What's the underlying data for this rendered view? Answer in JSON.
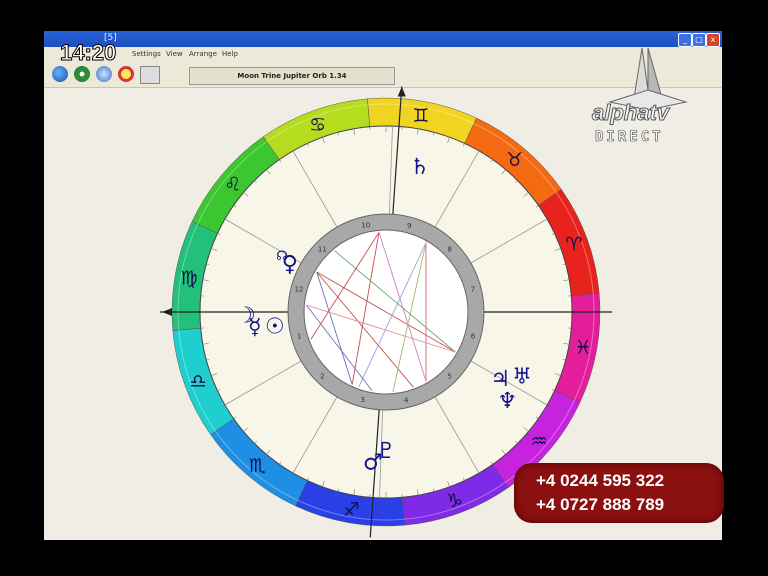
{
  "clock": "14:20",
  "window": {
    "title": "[5]",
    "menu": [
      "Settings",
      "View",
      "Arrange",
      "Help"
    ],
    "controls": [
      "minimize",
      "maximize",
      "close"
    ]
  },
  "toolbar": {
    "aspect_text": "Moon Trine Jupiter  Orb  1.34",
    "icons": [
      "globe-icon",
      "crosshair-icon",
      "feather-icon",
      "circle-icon",
      "chart-icon"
    ]
  },
  "wheel": {
    "house_numbers": [
      "1",
      "2",
      "3",
      "4",
      "5",
      "6",
      "7",
      "8",
      "9",
      "10",
      "11",
      "12"
    ],
    "signs": [
      {
        "name": "aries",
        "glyph": "♈",
        "color": "#e8231d"
      },
      {
        "name": "taurus",
        "glyph": "♉",
        "color": "#f36a12"
      },
      {
        "name": "gemini",
        "glyph": "♊",
        "color": "#f1d41f"
      },
      {
        "name": "cancer",
        "glyph": "♋",
        "color": "#b6dc1e"
      },
      {
        "name": "leo",
        "glyph": "♌",
        "color": "#3cc630"
      },
      {
        "name": "virgo",
        "glyph": "♍",
        "color": "#22c07a"
      },
      {
        "name": "libra",
        "glyph": "♎",
        "color": "#1fcfd0"
      },
      {
        "name": "scorpio",
        "glyph": "♏",
        "color": "#1e8fe4"
      },
      {
        "name": "sagittarius",
        "glyph": "♐",
        "color": "#2a3fe6"
      },
      {
        "name": "capricorn",
        "glyph": "♑",
        "color": "#7e2ae6"
      },
      {
        "name": "aquarius",
        "glyph": "♒",
        "color": "#c722de"
      },
      {
        "name": "pisces",
        "glyph": "♓",
        "color": "#e41e9a"
      }
    ],
    "planets": [
      {
        "name": "saturn",
        "glyph": "♄"
      },
      {
        "name": "node",
        "glyph": "☊"
      },
      {
        "name": "venus",
        "glyph": "♀"
      },
      {
        "name": "moon",
        "glyph": "☽"
      },
      {
        "name": "sun",
        "glyph": "☉"
      },
      {
        "name": "mercury",
        "glyph": "☿"
      },
      {
        "name": "uranus",
        "glyph": "♅"
      },
      {
        "name": "jupiter",
        "glyph": "♃"
      },
      {
        "name": "neptune",
        "glyph": "♆"
      },
      {
        "name": "pluto",
        "glyph": "♇"
      },
      {
        "name": "mars",
        "glyph": "♂"
      }
    ]
  },
  "brand": {
    "name": "alphatv",
    "sub": "DIRECT"
  },
  "phones": [
    "+4 0244 595 322",
    "+4 0727 888 789"
  ]
}
